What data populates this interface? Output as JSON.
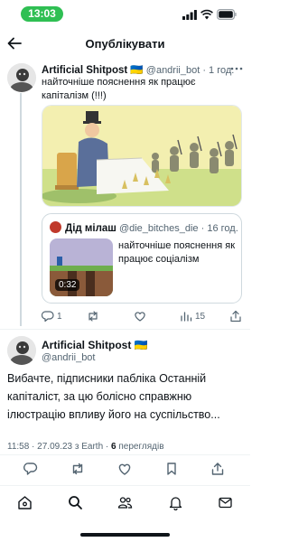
{
  "status_bar": {
    "time": "13:03"
  },
  "header": {
    "title": "Опублікувати"
  },
  "tweet1": {
    "author_name": "Artificial Shitpost 🇺🇦",
    "author_handle": "@andrii_bot",
    "time": "· 1 год.",
    "text": "найточніше пояснення як працює капіталізм (!!!)",
    "quote": {
      "author_name": "Дід мілаш",
      "author_handle": "@die_bitches_die",
      "time": "· 16 год.",
      "text": "найточніше пояснення як працює соціалізм",
      "video_duration": "0:32"
    },
    "stats": {
      "replies": "1",
      "views": "15"
    }
  },
  "tweet2": {
    "author_name": "Artificial Shitpost 🇺🇦",
    "author_handle": "@andrii_bot",
    "text": "Вибачте, підписники пабліка Останній капіталіст, за цю болісно справжню ілюстрацію впливу його на суспільство...",
    "meta_prefix": "11:58 · 27.09.23 з Earth · ",
    "views_count": "6",
    "views_label": " переглядів"
  },
  "colors": {
    "status_pill": "#2fbf53",
    "text": "#0f1419",
    "muted": "#536471",
    "border": "#cfd9de"
  },
  "icons": [
    "back-arrow-icon",
    "more-icon",
    "reply-icon",
    "retweet-icon",
    "like-icon",
    "views-icon",
    "share-icon",
    "bookmark-icon",
    "home-icon",
    "search-icon",
    "communities-icon",
    "notifications-icon",
    "messages-icon"
  ]
}
